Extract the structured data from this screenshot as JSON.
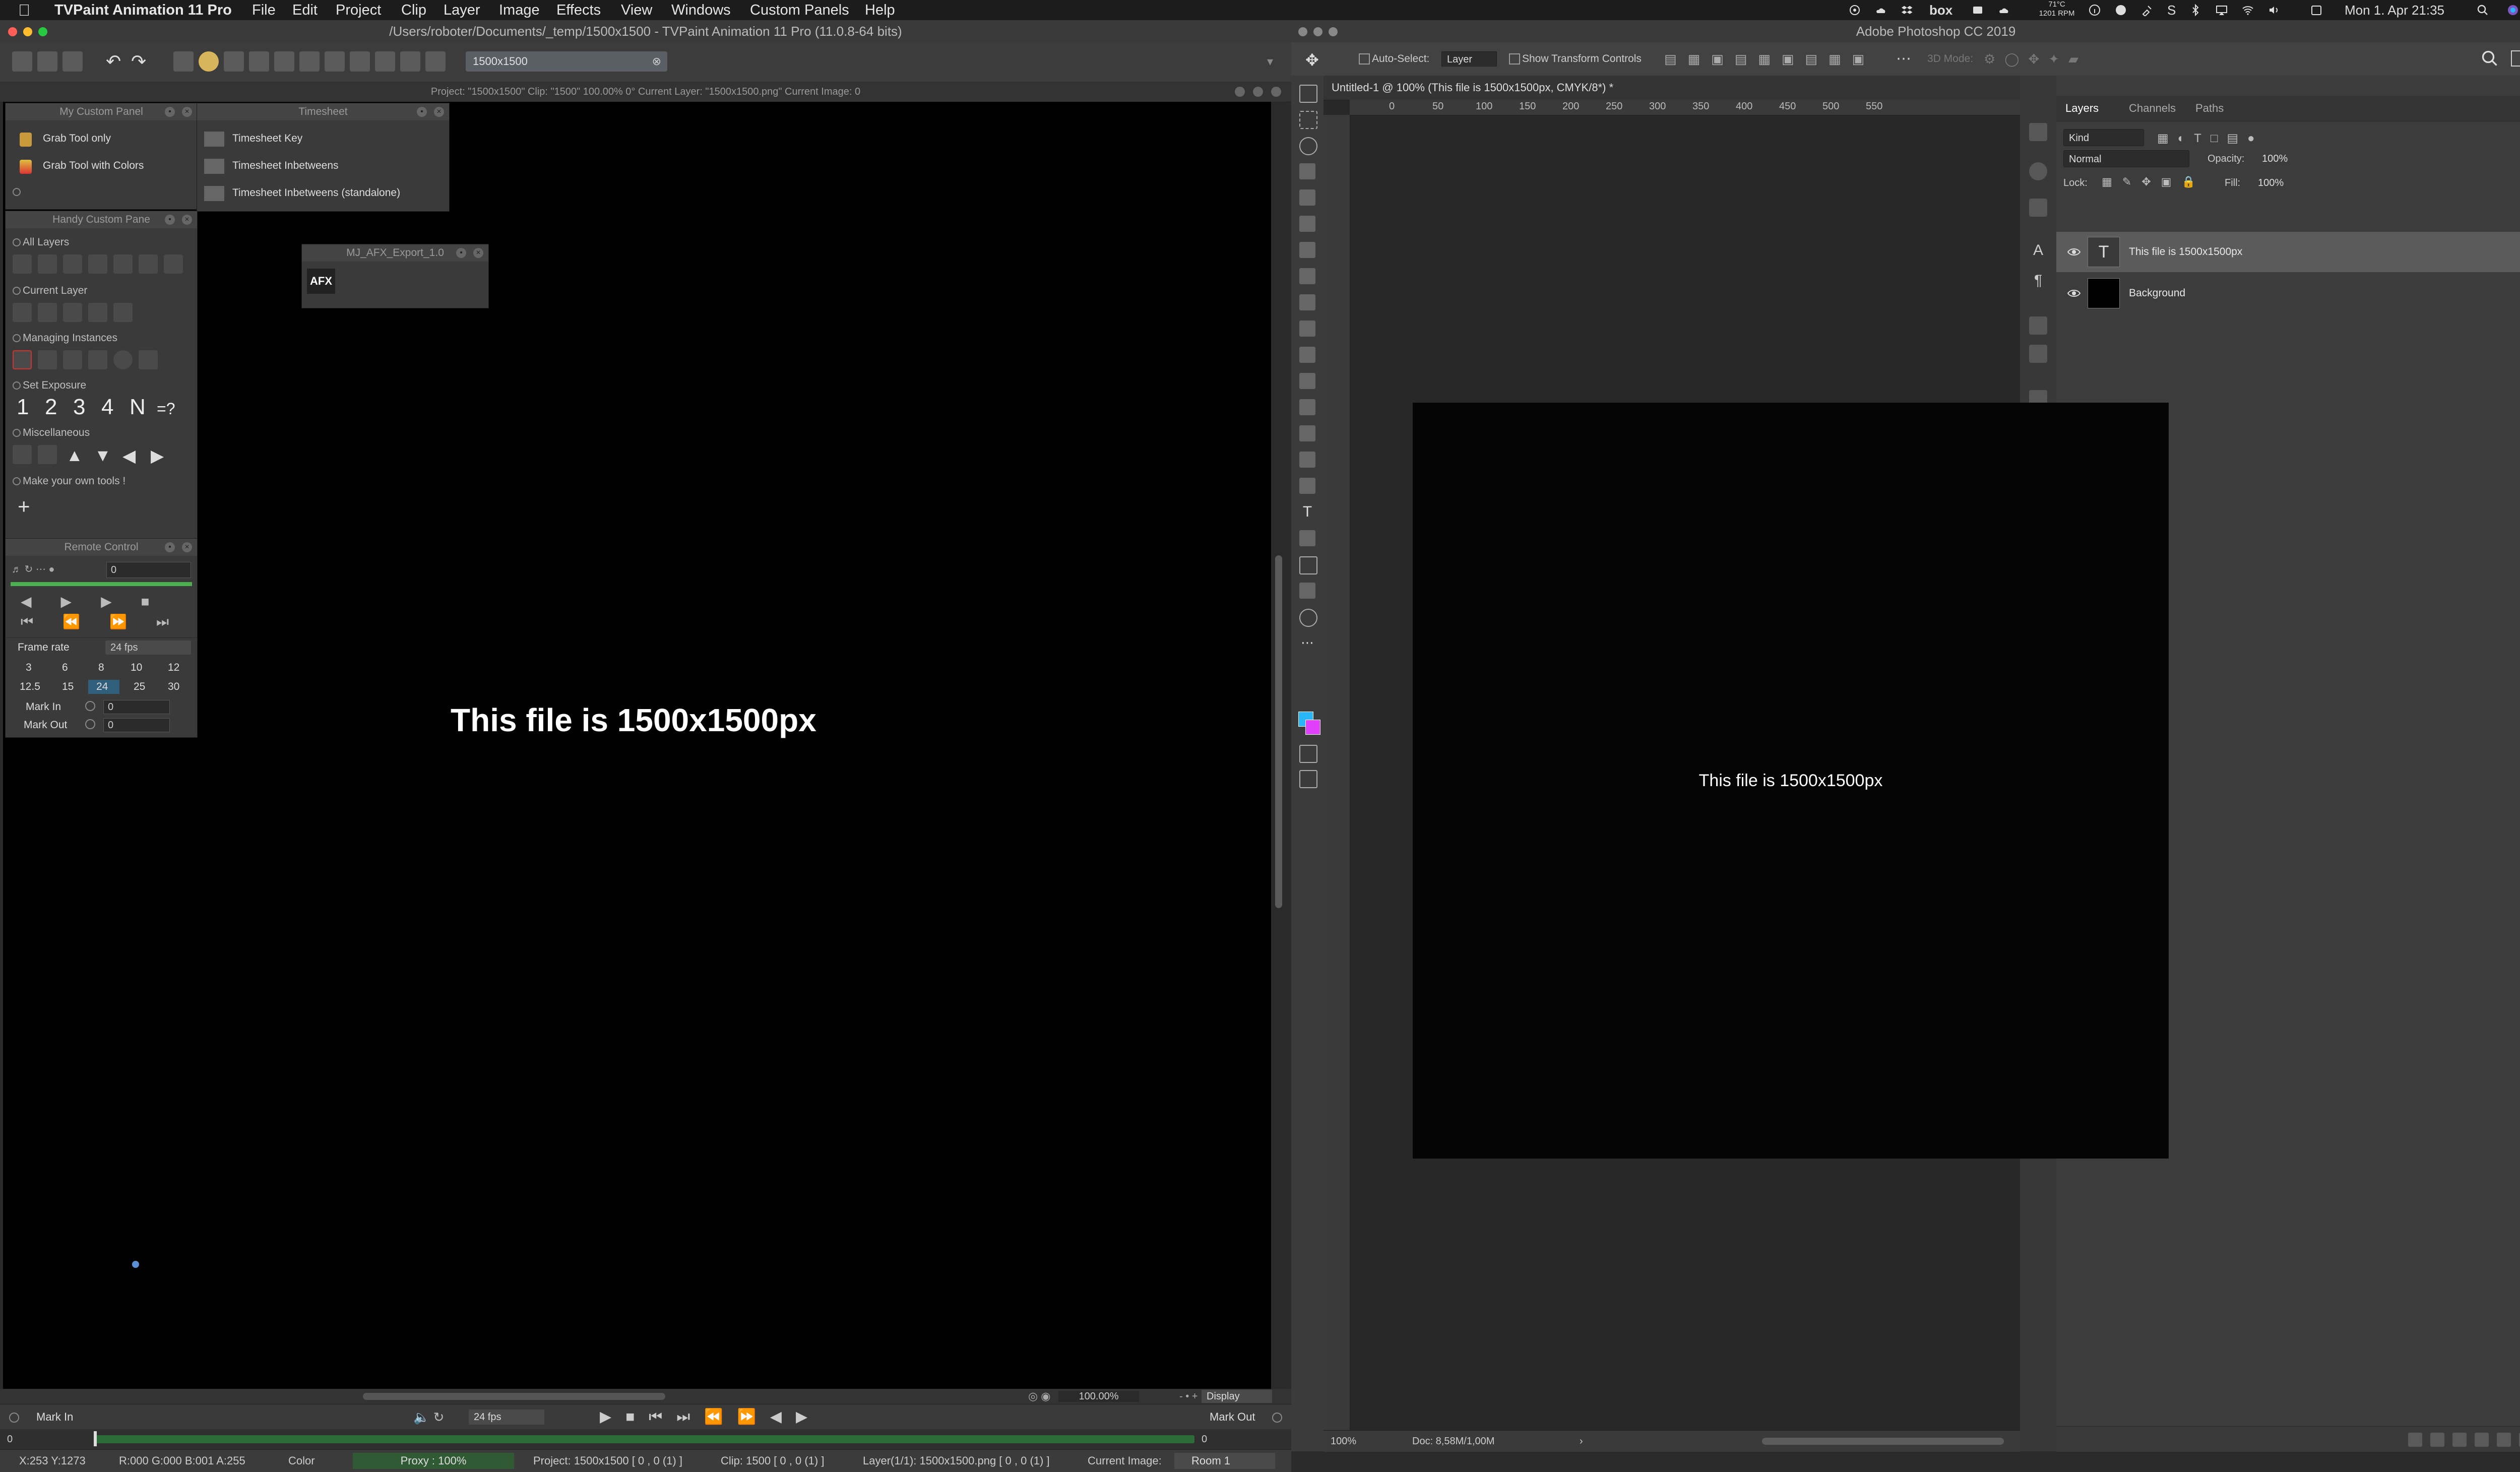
{
  "menubar": {
    "app_name": "TVPaint Animation 11 Pro",
    "menus": [
      "File",
      "Edit",
      "Project",
      "Clip",
      "Layer",
      "Image",
      "Effects",
      "View",
      "Windows",
      "Custom Panels",
      "Help"
    ],
    "status": {
      "box_label": "box",
      "temp": "71°C",
      "rpm": "1201 RPM",
      "datetime": "Mon 1. Apr  21:35"
    }
  },
  "tvpaint": {
    "window_title": "/Users/roboter/Documents/_temp/1500x1500 - TVPaint Animation 11 Pro (11.0.8-64 bits)",
    "toolbar_field": "1500x1500",
    "info_line": "Project: \"1500x1500\"  Clip: \"1500\"   100.00%   0°  Current Layer: \"1500x1500.png\"  Current Image: 0",
    "canvas_text": "This file is 1500x1500px",
    "panels": {
      "my_custom": {
        "title": "My Custom Panel",
        "items": [
          "Grab Tool only",
          "Grab Tool with Colors"
        ]
      },
      "timesheet": {
        "title": "Timesheet",
        "items": [
          "Timesheet Key",
          "Timesheet Inbetweens",
          "Timesheet Inbetweens (standalone)"
        ]
      },
      "afx": {
        "title": "MJ_AFX_Export_1.0",
        "icon_label": "AFX"
      },
      "handy": {
        "title": "Handy Custom Pane",
        "sections": [
          "All Layers",
          "Current Layer",
          "Managing Instances",
          "Set Exposure",
          "Miscellaneous",
          "Make your own tools !"
        ],
        "exposure": [
          "1",
          "2",
          "3",
          "4",
          "N",
          "=?"
        ],
        "add_label": "+"
      },
      "remote": {
        "title": "Remote Control",
        "frame_field": "0",
        "frame_rate_label": "Frame rate",
        "frame_rate_value": "24 fps",
        "rates_row1": [
          "3",
          "6",
          "8",
          "10",
          "12"
        ],
        "rates_row2": [
          "12.5",
          "15",
          "24",
          "25",
          "30"
        ],
        "mark_in_label": "Mark In",
        "mark_in_value": "0",
        "mark_out_label": "Mark Out",
        "mark_out_value": "0"
      }
    },
    "zoom": "100.00%",
    "display_label": "Display",
    "timeline": {
      "mark_in": "Mark In",
      "fps": "24 fps",
      "mark_out": "Mark Out",
      "start": "0",
      "end": "0"
    },
    "status": {
      "coords": "X:253  Y:1273",
      "rgba": "R:000 G:000 B:001 A:255",
      "color": "Color",
      "proxy": "Proxy : 100%",
      "project": "Project: 1500x1500 [ 0 , 0  (1) ]",
      "clip": "Clip: 1500 [ 0 , 0  (1) ]",
      "layer": "Layer(1/1): 1500x1500.png [ 0 , 0  (1) ]",
      "current_image": "Current Image:",
      "room": "Room 1"
    }
  },
  "photoshop": {
    "window_title": "Adobe Photoshop CC 2019",
    "options": {
      "auto_select": "Auto-Select:",
      "layer_select": "Layer",
      "show_transform": "Show Transform Controls",
      "mode_3d": "3D Mode:"
    },
    "doc_tab": "Untitled-1 @ 100% (This file is 1500x1500px, CMYK/8*) *",
    "ruler_ticks": [
      "0",
      "50",
      "100",
      "150",
      "200",
      "250",
      "300",
      "350",
      "400",
      "450",
      "500",
      "550"
    ],
    "canvas_text": "This file is 1500x1500px",
    "zoom": "100%",
    "doc_size": "Doc: 8,58M/1,00M",
    "layers_panel": {
      "tabs": [
        "Layers",
        "Channels",
        "Paths"
      ],
      "filter": "Kind",
      "blend": "Normal",
      "opacity_label": "Opacity:",
      "opacity": "100%",
      "lock_label": "Lock:",
      "fill_label": "Fill:",
      "fill": "100%",
      "layers": [
        {
          "name": "This file is 1500x1500px",
          "type": "text"
        },
        {
          "name": "Background",
          "type": "pixel"
        }
      ]
    },
    "colors": {
      "fg": "#29b6f6",
      "bg": "#e040fb"
    }
  }
}
